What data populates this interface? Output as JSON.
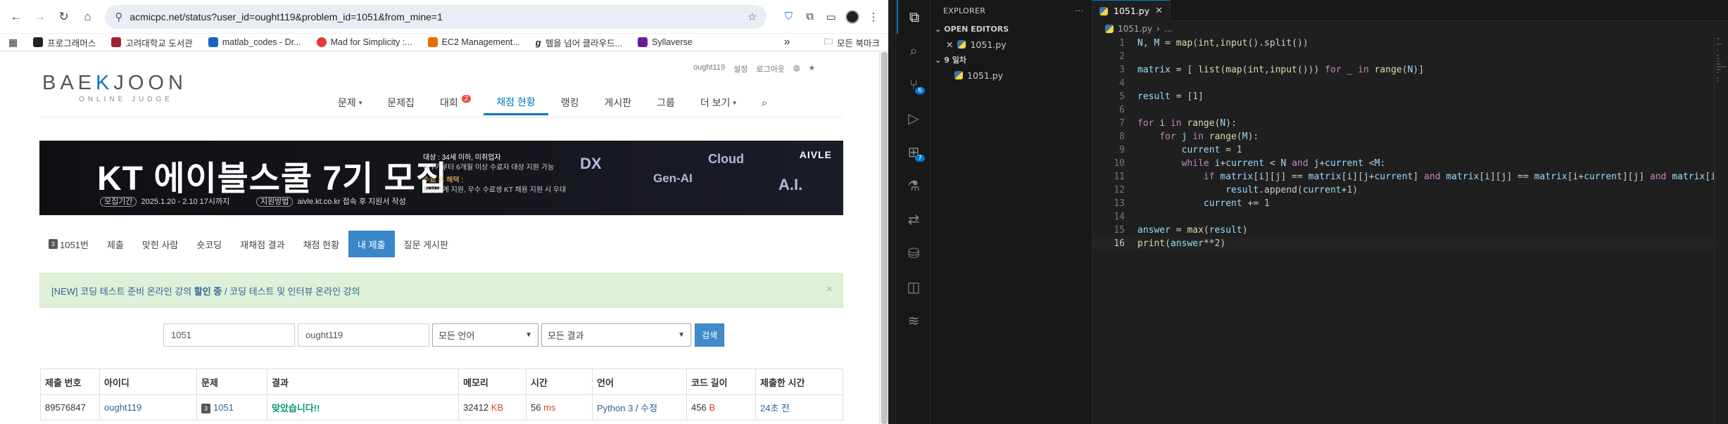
{
  "browser": {
    "url": "acmicpc.net/status?user_id=ought119&problem_id=1051&from_mine=1",
    "bookmarks": [
      "프로그래머스",
      "고려대학교 도서관",
      "matlab_codes - Dr...",
      "Mad for Simplicity :...",
      "EC2 Management...",
      "헬을 넘어 클라우드...",
      "Syllaverse"
    ],
    "bookmark_colors": [
      "#222222",
      "#a31f34",
      "#1565c0",
      "#e53935",
      "#ef6c00",
      "#222222",
      "#6a1b9a"
    ],
    "more_label": "»",
    "all_bookmarks": "모든 북마크"
  },
  "site": {
    "logo": {
      "before": "BAE",
      "k": "K",
      "after": "JOON",
      "sub": "ONLINE JUDGE"
    },
    "top_links": [
      "ought119",
      "설정",
      "로그아웃"
    ],
    "nav": [
      {
        "label": "문제",
        "caret": "▾"
      },
      {
        "label": "문제집",
        "caret": ""
      },
      {
        "label": "대회",
        "caret": "",
        "badge": "2"
      },
      {
        "label": "채점 현황",
        "caret": "",
        "active": true
      },
      {
        "label": "랭킹",
        "caret": ""
      },
      {
        "label": "게시판",
        "caret": ""
      },
      {
        "label": "그룹",
        "caret": ""
      },
      {
        "label": "더 보기",
        "caret": "▾"
      }
    ],
    "banner": {
      "headline": "KT 에이블스쿨 7기 모집",
      "period_tag": "모집기간",
      "period": "2025.1.20 - 2.10 17시까지",
      "apply_tag": "지원방법",
      "apply": "aivle.kt.co.kr 접속 후 지원서 작성",
      "info": [
        "대상 : 34세 이하, 미취업자",
        "※ 7기부터 6개월 이상 수료자 대상 지원 가능",
        "수료 후 혜택 :",
        "채용연계 지원, 우수 수료생 KT 채용 지원 시 우대"
      ],
      "tags": [
        "DX",
        "Gen-AI",
        "Cloud",
        "A.I."
      ],
      "brand": "AIVLE"
    },
    "subnav": [
      {
        "label": "1051번",
        "problem_badge": "3"
      },
      {
        "label": "제출"
      },
      {
        "label": "맞힌 사람"
      },
      {
        "label": "숏코딩"
      },
      {
        "label": "재채점 결과"
      },
      {
        "label": "채점 현황"
      },
      {
        "label": "내 제출",
        "active": true
      },
      {
        "label": "질문 게시판"
      }
    ],
    "alert": {
      "prefix": "[NEW] 코딩 테스트 준비 온라인 강의 ",
      "bold": "할인 중",
      "suffix": " / 코딩 테스트 및 인터뷰 온라인 강의",
      "close": "×"
    },
    "filters": {
      "problem_id": "1051",
      "user_id": "ought119",
      "language": "모든 언어",
      "result": "모든 결과",
      "search": "검색"
    },
    "table": {
      "headers": [
        "제출 번호",
        "아이디",
        "문제",
        "결과",
        "메모리",
        "시간",
        "언어",
        "코드 길이",
        "제출한 시간"
      ],
      "row": {
        "id": "89576847",
        "user": "ought119",
        "problem_badge": "3",
        "problem": "1051",
        "result": "맞았습니다!!",
        "memory": "32412",
        "memory_unit": "KB",
        "time": "56",
        "time_unit": "ms",
        "language": "Python 3",
        "edit": "수정",
        "code_length": "456",
        "code_unit": "B",
        "submitted": "24초 전"
      }
    }
  },
  "vscode": {
    "explorer_title": "EXPLORER",
    "open_editors_label": "OPEN EDITORS",
    "folder_label": "9 일차",
    "file": "1051.py",
    "breadcrumb_more": "...",
    "activity_badges": {
      "scm": "6",
      "extensions": "7"
    },
    "code_lines": [
      "N, M = map(int,input().split())",
      "",
      "matrix = [ list(map(int,input())) for _ in range(N)]",
      "",
      "result = [1]",
      "",
      "for i in range(N):",
      "    for j in range(M):",
      "        current = 1",
      "        while i+current < N and j+current <M:",
      "            if matrix[i][j] == matrix[i][j+current] and matrix[i][j] == matrix[i+current][j] and matrix[i",
      "                result.append(current+1)",
      "            current += 1",
      "",
      "answer = max(result)",
      "print(answer**2)"
    ],
    "current_line": 16
  }
}
